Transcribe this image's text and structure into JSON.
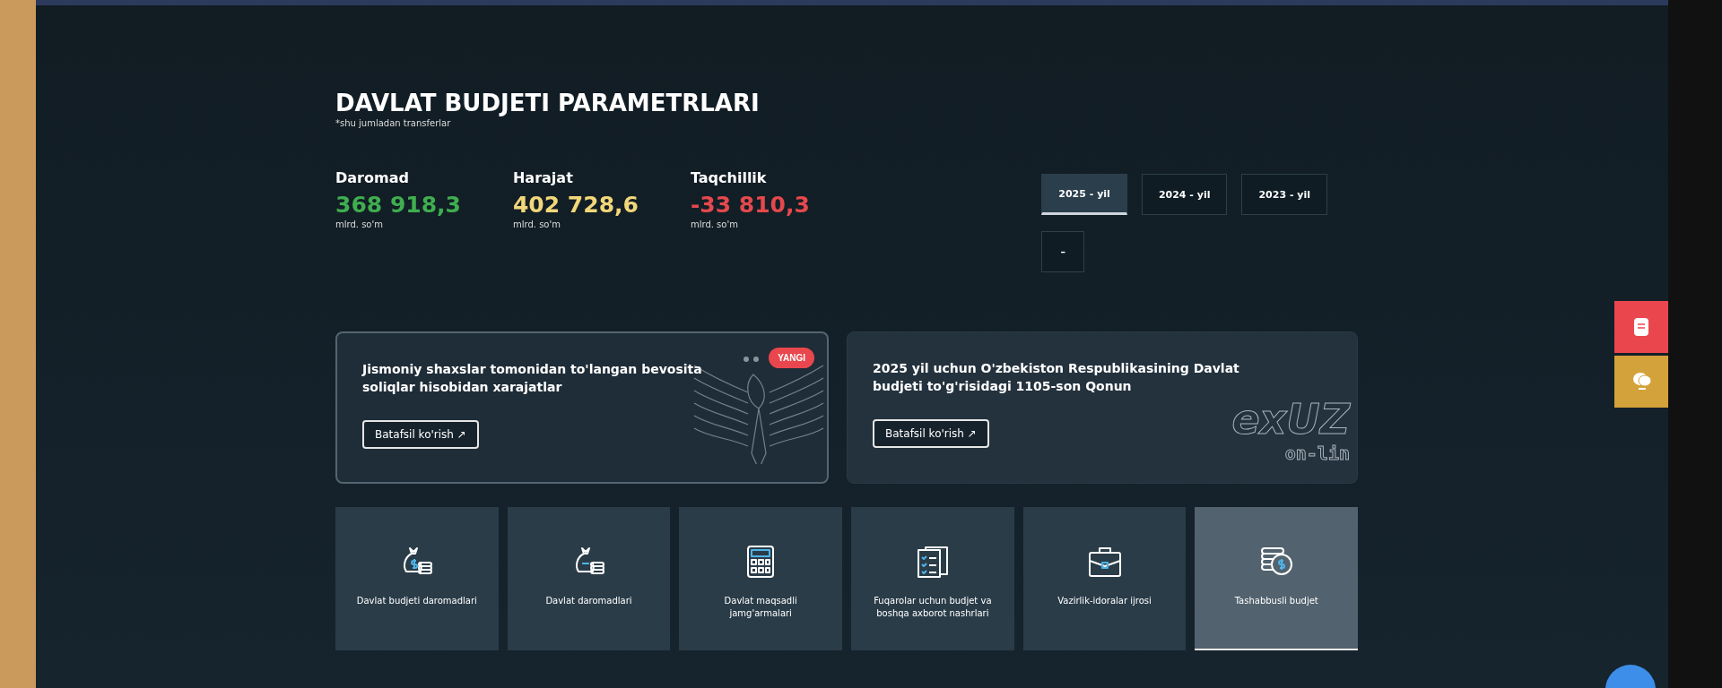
{
  "header": {
    "title": "DAVLAT BUDJETI PARAMETRLARI",
    "note": "*shu jumladan transferlar"
  },
  "stats": [
    {
      "label": "Daromad",
      "value": "368 918,3",
      "unit": "mlrd. so'm",
      "color": "#3fae4f"
    },
    {
      "label": "Harajat",
      "value": "402 728,6",
      "unit": "mlrd. so'm",
      "color": "#f2d77a"
    },
    {
      "label": "Taqchillik",
      "value": "-33 810,3",
      "unit": "mlrd. so'm",
      "color": "#e5484d"
    }
  ],
  "year_tabs": [
    {
      "label": "2025 - yil",
      "selected": true
    },
    {
      "label": "2024 - yil",
      "selected": false
    },
    {
      "label": "2023 - yil",
      "selected": false
    },
    {
      "label": "–",
      "selected": false
    }
  ],
  "cards": [
    {
      "kind": "eagle",
      "title": "Jismoniy shaxslar tomonidan to'langan bevosita soliqlar hisobidan xarajatlar",
      "badge": "YANGI",
      "link": "Batafsil ko'rish ↗"
    },
    {
      "kind": "lex",
      "title": "2025 yil uchun O'zbekiston Respublikasining Davlat budjeti to'g'risidagi 1105-son Qonun",
      "logo": "exUZ",
      "logo_sub": "on-lin",
      "link": "Batafsil ko'rish ↗"
    }
  ],
  "tiles": [
    {
      "kind": "money-bag",
      "label": "Davlat budjeti daromadlari",
      "selected": false
    },
    {
      "kind": "money-bag-minus",
      "label": "Davlat daromadlari",
      "selected": false
    },
    {
      "kind": "calculator",
      "label": "Davlat maqsadli jamg'armalari",
      "selected": false
    },
    {
      "kind": "clipboard",
      "label": "Fuqarolar uchun budjet va boshqa axborot nashrlari",
      "selected": false
    },
    {
      "kind": "briefcase",
      "label": "Vazirlik-idoralar ijrosi",
      "selected": false
    },
    {
      "kind": "coins",
      "label": "Tashabbusli budjet",
      "selected": true
    }
  ],
  "side_buttons": [
    {
      "kind": "document",
      "color": "#e9474d"
    },
    {
      "kind": "chat",
      "color": "#d4a23a"
    }
  ]
}
